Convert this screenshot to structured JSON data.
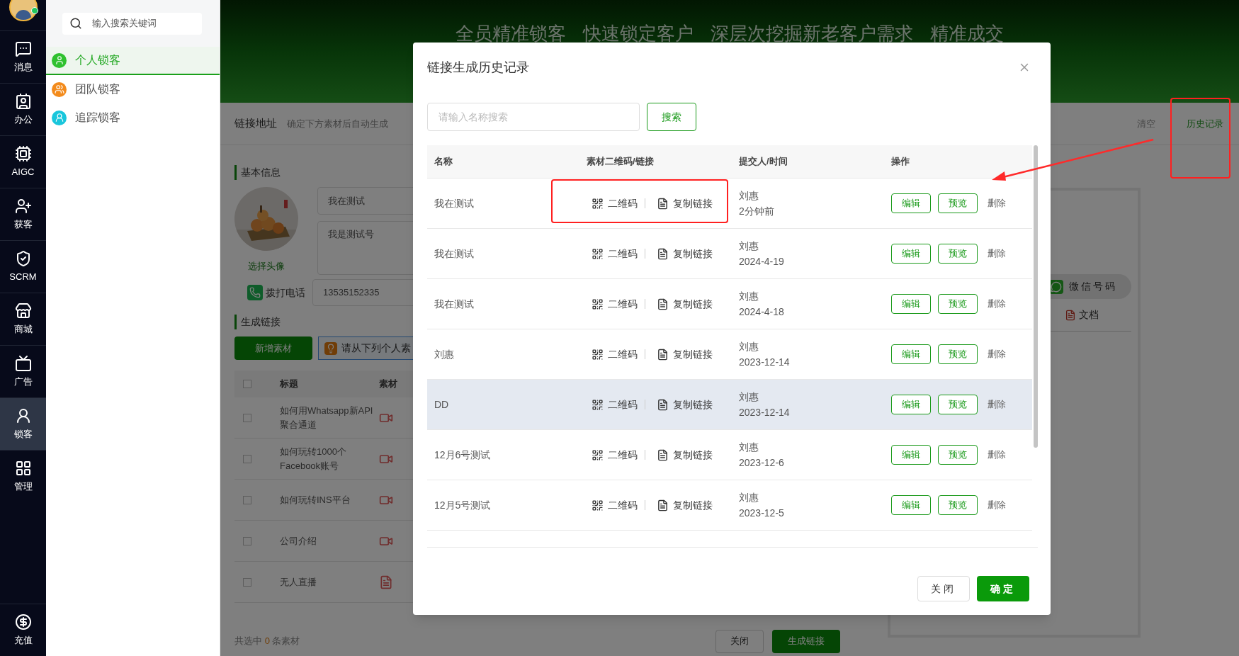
{
  "rail": {
    "items": [
      {
        "label": "消息",
        "selected": false
      },
      {
        "label": "办公",
        "selected": false
      },
      {
        "label": "AIGC",
        "selected": false
      },
      {
        "label": "获客",
        "selected": false
      },
      {
        "label": "SCRM",
        "selected": false
      },
      {
        "label": "商城",
        "selected": false
      },
      {
        "label": "广告",
        "selected": false
      },
      {
        "label": "锁客",
        "selected": true
      },
      {
        "label": "管理",
        "selected": false
      }
    ],
    "bottom": "充值"
  },
  "sidebar": {
    "search_placeholder": "输入搜索关键词",
    "items": [
      {
        "label": "个人锁客",
        "selected": true,
        "color": "#2fc12f"
      },
      {
        "label": "团队锁客",
        "selected": false,
        "color": "#f38b1c"
      },
      {
        "label": "追踪锁客",
        "selected": false,
        "color": "#19c6dc"
      }
    ]
  },
  "banner": {
    "slogans": [
      "全员精准锁客",
      "快速锁定客户",
      "深层次挖掘新老客户需求",
      "精准成交"
    ]
  },
  "link_bar": {
    "label": "链接地址",
    "hint": "确定下方素材后自动生成",
    "clear": "清空",
    "history": "历史记录"
  },
  "basic_info": {
    "title": "基本信息",
    "name_value": "我在测试",
    "desc_value": "我是测试号",
    "choose_avatar": "选择头像",
    "call_label": "拨打电话",
    "phone_value": "13535152335"
  },
  "generate": {
    "title": "生成链接",
    "add_button": "新增素材",
    "tip": "请从下列个人素",
    "all_checked": false,
    "columns": [
      "标题",
      "素材"
    ],
    "rows": [
      {
        "title": "如何用Whatsapp新API聚合通道",
        "kind": "video",
        "checked": false
      },
      {
        "title": "如何玩转1000个Facebook账号",
        "kind": "video",
        "checked": false
      },
      {
        "title": "如何玩转INS平台",
        "kind": "video",
        "checked": false
      },
      {
        "title": "公司介绍",
        "kind": "video",
        "checked": false
      },
      {
        "title": "无人直播",
        "kind": "pdf",
        "checked": false
      }
    ]
  },
  "footer": {
    "selected_prefix": "共选中",
    "count": "0",
    "selected_suffix": "条素材",
    "close": "关闭",
    "generate": "生成链接"
  },
  "right_panel": {
    "wechat": "微信号码",
    "doc": "文档"
  },
  "modal": {
    "title": "链接生成历史记录",
    "search_placeholder": "请输入名称搜索",
    "search_button": "搜索",
    "columns": [
      "名称",
      "素材二维码/链接",
      "提交人/时间",
      "操作"
    ],
    "rows": [
      {
        "name": "我在测试",
        "qr": "二维码",
        "copy": "复制链接",
        "submitter": "刘惠",
        "time": "2分钟前",
        "edit": "编辑",
        "preview": "预览",
        "delete": "删除",
        "hovered": false
      },
      {
        "name": "我在测试",
        "qr": "二维码",
        "copy": "复制链接",
        "submitter": "刘惠",
        "time": "2024-4-19",
        "edit": "编辑",
        "preview": "预览",
        "delete": "删除",
        "hovered": false
      },
      {
        "name": "我在测试",
        "qr": "二维码",
        "copy": "复制链接",
        "submitter": "刘惠",
        "time": "2024-4-18",
        "edit": "编辑",
        "preview": "预览",
        "delete": "删除",
        "hovered": false
      },
      {
        "name": "刘惠",
        "qr": "二维码",
        "copy": "复制链接",
        "submitter": "刘惠",
        "time": "2023-12-14",
        "edit": "编辑",
        "preview": "预览",
        "delete": "删除",
        "hovered": false
      },
      {
        "name": "DD",
        "qr": "二维码",
        "copy": "复制链接",
        "submitter": "刘惠",
        "time": "2023-12-14",
        "edit": "编辑",
        "preview": "预览",
        "delete": "删除",
        "hovered": true
      },
      {
        "name": "12月6号测试",
        "qr": "二维码",
        "copy": "复制链接",
        "submitter": "刘惠",
        "time": "2023-12-6",
        "edit": "编辑",
        "preview": "预览",
        "delete": "删除",
        "hovered": false
      },
      {
        "name": "12月5号测试",
        "qr": "二维码",
        "copy": "复制链接",
        "submitter": "刘惠",
        "time": "2023-12-5",
        "edit": "编辑",
        "preview": "预览",
        "delete": "删除",
        "hovered": false
      }
    ],
    "cancel": "关闭",
    "confirm": "确定"
  }
}
